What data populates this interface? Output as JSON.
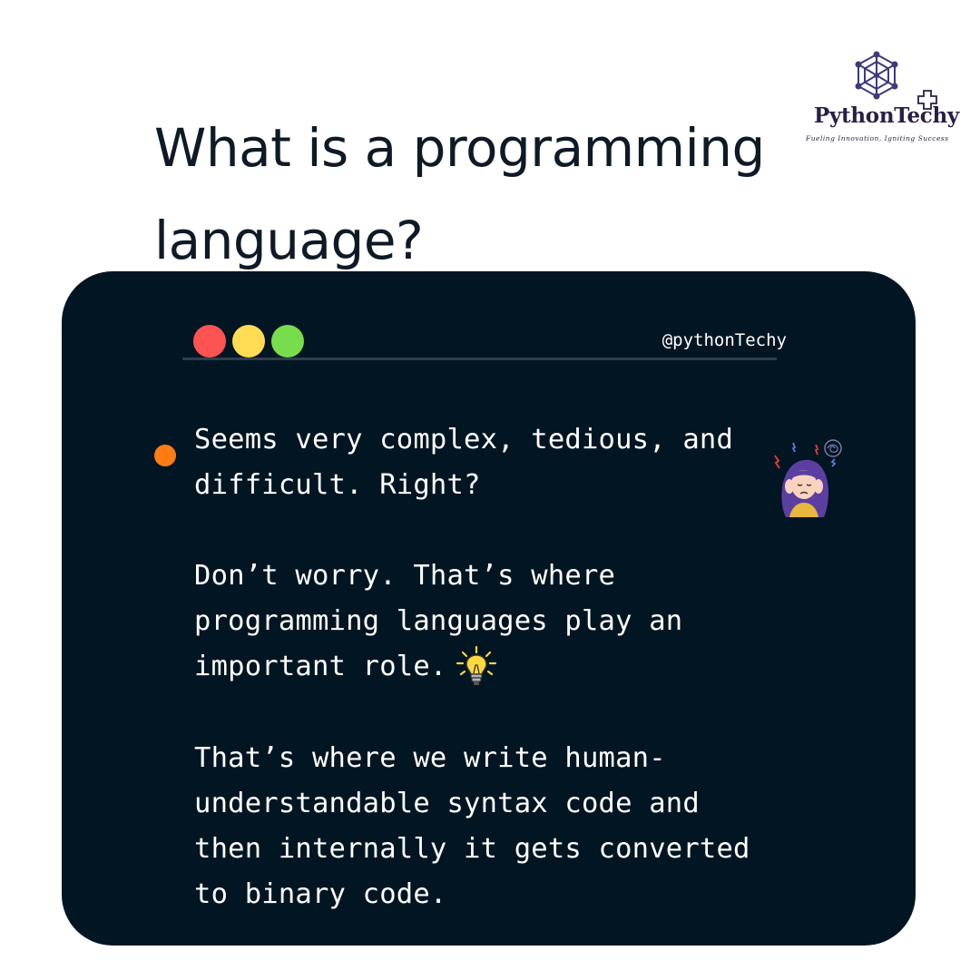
{
  "title": [
    "What is a programming",
    "language?"
  ],
  "brand": {
    "name": "PythonTechy",
    "tagline": "Fueling Innovation, Igniting Success",
    "color": "#2a1f47"
  },
  "card": {
    "background": "#021523",
    "handle": "@pythonTechy",
    "window_dots": [
      "red",
      "yellow",
      "green"
    ],
    "bullet_color": "#ff7b14",
    "paragraphs": [
      [
        "Seems very complex, tedious, and",
        "difficult. Right?"
      ],
      [
        "Don’t worry. That’s where",
        "programming languages play an",
        "important role."
      ],
      [
        "That’s where we write human-",
        "understandable syntax code and",
        "then internally it gets converted",
        "to binary code."
      ]
    ],
    "icons": [
      "stressed-person-icon",
      "lightbulb-icon"
    ]
  }
}
